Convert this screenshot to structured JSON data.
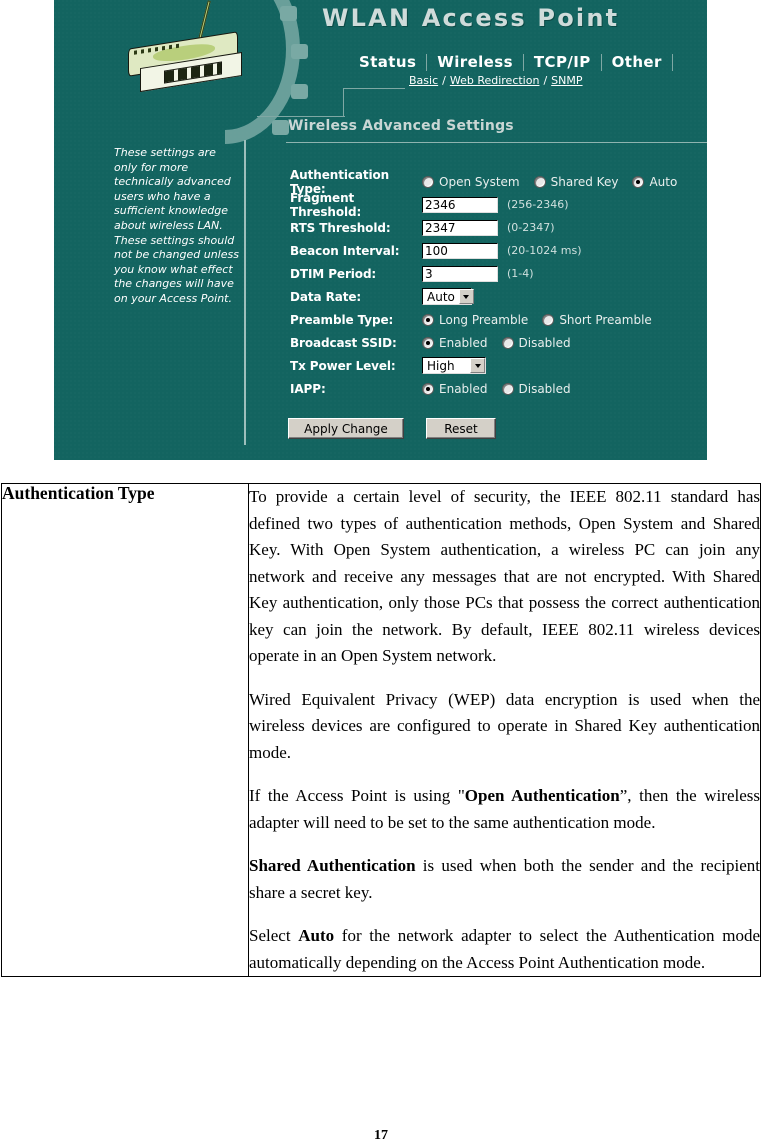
{
  "screenshot": {
    "title": "WLAN Access Point",
    "nav": {
      "tabs": [
        {
          "label": "Status"
        },
        {
          "label": "Wireless"
        },
        {
          "label": "TCP/IP"
        },
        {
          "label": "Other"
        }
      ],
      "subtabs": [
        {
          "label": "Basic"
        },
        {
          "label": "Web Redirection"
        },
        {
          "label": "SNMP"
        }
      ],
      "separator": "/"
    },
    "section_title": "Wireless Advanced Settings",
    "note": "These settings are only for more technically advanced users who have a sufficient knowledge about wireless LAN. These settings should not be changed unless you know what effect the changes will have on your Access Point.",
    "fields": {
      "auth_type": {
        "label": "Authentication Type:",
        "options": [
          {
            "label": "Open System",
            "selected": false
          },
          {
            "label": "Shared Key",
            "selected": false
          },
          {
            "label": "Auto",
            "selected": true
          }
        ]
      },
      "fragment_threshold": {
        "label": "Fragment Threshold:",
        "value": "2346",
        "hint": "(256-2346)"
      },
      "rts_threshold": {
        "label": "RTS Threshold:",
        "value": "2347",
        "hint": "(0-2347)"
      },
      "beacon_interval": {
        "label": "Beacon Interval:",
        "value": "100",
        "hint": "(20-1024 ms)"
      },
      "dtim_period": {
        "label": "DTIM Period:",
        "value": "3",
        "hint": "(1-4)"
      },
      "data_rate": {
        "label": "Data Rate:",
        "value": "Auto"
      },
      "preamble_type": {
        "label": "Preamble Type:",
        "options": [
          {
            "label": "Long Preamble",
            "selected": true
          },
          {
            "label": "Short Preamble",
            "selected": false
          }
        ]
      },
      "broadcast_ssid": {
        "label": "Broadcast SSID:",
        "options": [
          {
            "label": "Enabled",
            "selected": true
          },
          {
            "label": "Disabled",
            "selected": false
          }
        ]
      },
      "tx_power_level": {
        "label": "Tx Power Level:",
        "value": "High"
      },
      "iapp": {
        "label": "IAPP:",
        "options": [
          {
            "label": "Enabled",
            "selected": true
          },
          {
            "label": "Disabled",
            "selected": false
          }
        ]
      }
    },
    "buttons": {
      "apply": "Apply Change",
      "reset": "Reset"
    },
    "colors": {
      "background": "#136460",
      "accent_light": "#79a9a4",
      "title_text": "#cfdbda",
      "button_face": "#d4d0c8"
    }
  },
  "table": {
    "term": "Authentication Type",
    "paragraphs": [
      {
        "parts": [
          {
            "text": "To provide a certain level of security, the IEEE 802.11 standard has defined two types of authentication methods, Open System and Shared Key. With Open System authentication, a wireless PC can join any network and receive any messages that are not encrypted. With Shared Key authentication, only those PCs that possess the correct authentication key can join the network. By default, IEEE 802.11 wireless devices operate in an Open System network.",
            "bold": false
          }
        ]
      },
      {
        "parts": [
          {
            "text": "Wired Equivalent Privacy (WEP) data encryption is used when the wireless devices are configured to operate in Shared Key authentication mode.",
            "bold": false
          }
        ]
      },
      {
        "parts": [
          {
            "text": "If the Access Point is using \"",
            "bold": false
          },
          {
            "text": "Open Authentication",
            "bold": true
          },
          {
            "text": "”, then the wireless adapter will need to be set to the same authentication mode.",
            "bold": false
          }
        ]
      },
      {
        "parts": [
          {
            "text": "Shared Authentication",
            "bold": true
          },
          {
            "text": " is used when both the sender and the recipient share a secret key.",
            "bold": false
          }
        ]
      },
      {
        "parts": [
          {
            "text": "Select ",
            "bold": false
          },
          {
            "text": "Auto",
            "bold": true
          },
          {
            "text": " for the network adapter to select the Authentication mode automatically depending on the Access Point Authentication mode.",
            "bold": false
          }
        ]
      }
    ]
  },
  "page_number": "17"
}
